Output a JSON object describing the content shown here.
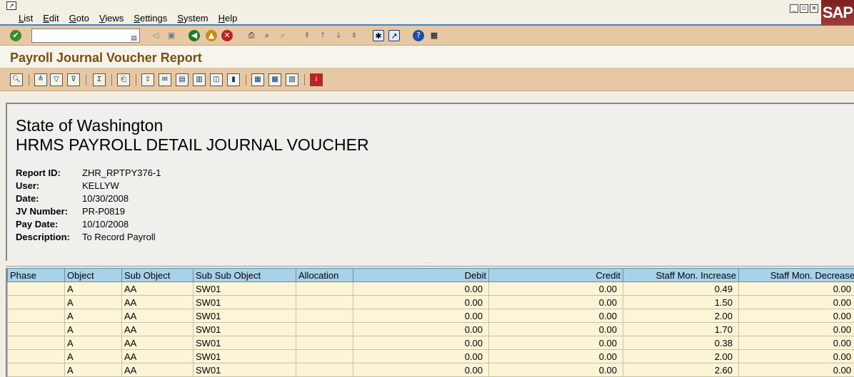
{
  "menu": {
    "items": [
      "List",
      "Edit",
      "Goto",
      "Views",
      "Settings",
      "System",
      "Help"
    ],
    "logo": "SAP"
  },
  "toolbar": {
    "command_value": ""
  },
  "title": "Payroll Journal Voucher Report",
  "header": {
    "organization": "State of Washington",
    "report_title": "HRMS PAYROLL DETAIL JOURNAL VOUCHER",
    "fields": [
      {
        "label": "Report ID:",
        "value": "ZHR_RPTPY376-1"
      },
      {
        "label": "User:",
        "value": "KELLYW"
      },
      {
        "label": "Date:",
        "value": "10/30/2008"
      },
      {
        "label": "JV Number:",
        "value": "PR-P0819"
      },
      {
        "label": "Pay Date:",
        "value": "10/10/2008"
      },
      {
        "label": "Description:",
        "value": "To Record Payroll"
      }
    ]
  },
  "grid": {
    "columns": [
      "Phase",
      "Object",
      "Sub Object",
      "Sub Sub Object",
      "Allocation",
      "Debit",
      "Credit",
      "Staff Mon. Increase",
      "Staff Mon. Decrease"
    ],
    "rows": [
      [
        "",
        "A",
        "AA",
        "SW01",
        "",
        "0.00",
        "0.00",
        "0.49",
        "0.00"
      ],
      [
        "",
        "A",
        "AA",
        "SW01",
        "",
        "0.00",
        "0.00",
        "1.50",
        "0.00"
      ],
      [
        "",
        "A",
        "AA",
        "SW01",
        "",
        "0.00",
        "0.00",
        "2.00",
        "0.00"
      ],
      [
        "",
        "A",
        "AA",
        "SW01",
        "",
        "0.00",
        "0.00",
        "1.70",
        "0.00"
      ],
      [
        "",
        "A",
        "AA",
        "SW01",
        "",
        "0.00",
        "0.00",
        "0.38",
        "0.00"
      ],
      [
        "",
        "A",
        "AA",
        "SW01",
        "",
        "0.00",
        "0.00",
        "2.00",
        "0.00"
      ],
      [
        "",
        "A",
        "AA",
        "SW01",
        "",
        "0.00",
        "0.00",
        "2.60",
        "0.00"
      ]
    ]
  },
  "colors": {
    "toolbar_bg": "#e6c9a4",
    "title_color": "#7a4f12",
    "grid_header_bg": "#a8d2ea",
    "grid_row_bg": "#fbf4d6"
  }
}
